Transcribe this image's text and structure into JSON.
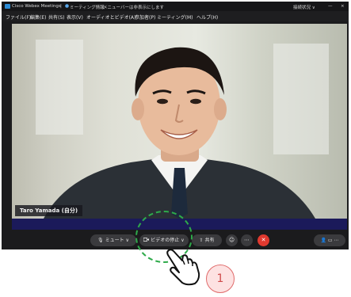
{
  "titlebar": {
    "app_name": "Cisco Webex Meetings",
    "separator": "|",
    "meeting_info": "ミーティング情報",
    "hint": "メニューバーは非表示にします",
    "right_text": "接続状況 ∨",
    "minimize": "—",
    "close": "×"
  },
  "menubar": {
    "items": [
      "ファイル(F)",
      "編集(E)",
      "共有(S)",
      "表示(V)",
      "オーディオとビデオ(A)",
      "参加者(P)",
      "ミーティング(M)",
      "ヘルプ(H)"
    ]
  },
  "video": {
    "participant_name": "Taro Yamada (自分)"
  },
  "controls": {
    "mute_label": "ミュート",
    "mute_chevron": "∨",
    "video_label": "ビデオの停止",
    "video_chevron": "∨",
    "share_label": "共有",
    "reaction_icon": "reaction-icon",
    "more_icon": "more-icon",
    "leave_icon": "leave-icon",
    "participants_icon": "participants-icon",
    "chat_icon": "chat-icon",
    "more_panels_icon": "more-panels-icon"
  },
  "annotation": {
    "step_number": "1",
    "highlight_color": "#2eaa4a",
    "step_color": "#cf4a4a"
  },
  "colors": {
    "leave": "#e0392f",
    "stripe": "#1b1a5a"
  }
}
